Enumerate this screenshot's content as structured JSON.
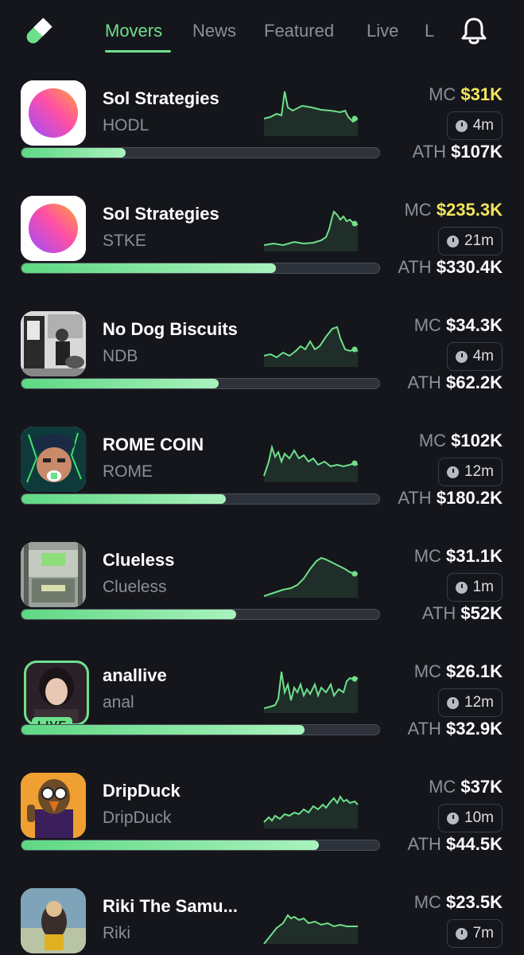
{
  "nav": {
    "tabs": [
      "Movers",
      "News",
      "Featured",
      "Live",
      "L"
    ],
    "active_tab": "Movers"
  },
  "icons": {
    "logo": "pill-logo-icon",
    "bell": "bell-icon",
    "clock": "clock-icon"
  },
  "colors": {
    "background": "#15161b",
    "accent_green": "#6ee08c",
    "mc_highlight": "#f2e65c",
    "muted_text": "#8b8f99"
  },
  "tokens": [
    {
      "name": "Sol Strategies",
      "ticker": "HODL",
      "mc_label": "MC",
      "mc": "$31K",
      "mc_highlight": true,
      "age": "4m",
      "ath_label": "ATH",
      "ath": "$107K",
      "progress": 0.29,
      "live": false
    },
    {
      "name": "Sol Strategies",
      "ticker": "STKE",
      "mc_label": "MC",
      "mc": "$235.3K",
      "mc_highlight": true,
      "age": "21m",
      "ath_label": "ATH",
      "ath": "$330.4K",
      "progress": 0.71,
      "live": false
    },
    {
      "name": "No Dog Biscuits",
      "ticker": "NDB",
      "mc_label": "MC",
      "mc": "$34.3K",
      "mc_highlight": false,
      "age": "4m",
      "ath_label": "ATH",
      "ath": "$62.2K",
      "progress": 0.55,
      "live": false
    },
    {
      "name": "ROME COIN",
      "ticker": "ROME",
      "mc_label": "MC",
      "mc": "$102K",
      "mc_highlight": false,
      "age": "12m",
      "ath_label": "ATH",
      "ath": "$180.2K",
      "progress": 0.57,
      "live": false
    },
    {
      "name": "Clueless",
      "ticker": "Clueless",
      "mc_label": "MC",
      "mc": "$31.1K",
      "mc_highlight": false,
      "age": "1m",
      "ath_label": "ATH",
      "ath": "$52K",
      "progress": 0.6,
      "live": false
    },
    {
      "name": "anallive",
      "ticker": "anal",
      "mc_label": "MC",
      "mc": "$26.1K",
      "mc_highlight": false,
      "age": "12m",
      "ath_label": "ATH",
      "ath": "$32.9K",
      "progress": 0.79,
      "live": true,
      "live_label": "LIVE"
    },
    {
      "name": "DripDuck",
      "ticker": "DripDuck",
      "mc_label": "MC",
      "mc": "$37K",
      "mc_highlight": false,
      "age": "10m",
      "ath_label": "ATH",
      "ath": "$44.5K",
      "progress": 0.83,
      "live": false
    },
    {
      "name": "Riki The Samu...",
      "ticker": "Riki",
      "mc_label": "MC",
      "mc": "$23.5K",
      "mc_highlight": false,
      "age": "7m",
      "ath_label": "",
      "ath": "",
      "progress": null,
      "live": false
    }
  ]
}
